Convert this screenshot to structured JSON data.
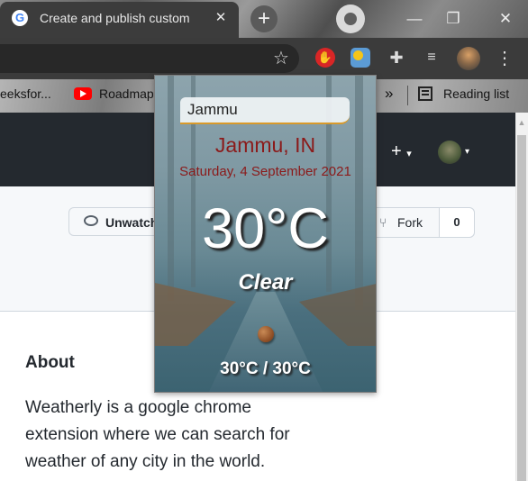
{
  "browser": {
    "tab_title": "Create and publish custom",
    "tab_close": "✕",
    "new_tab": "+",
    "window_controls": {
      "minimize": "—",
      "restore": "❐",
      "close": "✕"
    }
  },
  "toolbar": {
    "star_icon": "star-icon",
    "extensions": [
      "adblock-icon",
      "weather-icon",
      "puzzle-icon",
      "media-icon"
    ],
    "menu": "⋮"
  },
  "bookmarks": {
    "items": [
      "eeksfor...",
      "Roadmap"
    ],
    "overflow": "»",
    "reading_list": "Reading list"
  },
  "page": {
    "watch_label": "Unwatch",
    "fork_label": "Fork",
    "fork_count": "0",
    "about_heading": "About",
    "about_text": "Weatherly is a google chrome extension where we can search for weather of any city in the world."
  },
  "popup": {
    "search_value": "Jammu",
    "location": "Jammu, IN",
    "date": "Saturday, 4 September 2021",
    "temperature": "30°C",
    "condition": "Clear",
    "min_max": "30°C / 30°C",
    "accent_color": "#8b1a1a"
  }
}
